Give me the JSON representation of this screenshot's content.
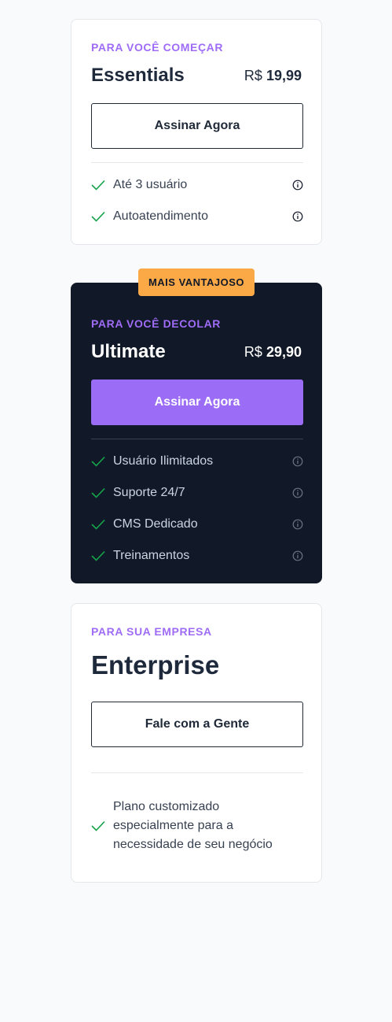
{
  "plans": [
    {
      "eyebrow": "PARA VOCÊ COMEÇAR",
      "name": "Essentials",
      "currency": "R$",
      "amount": "19,99",
      "cta": "Assinar Agora",
      "features": [
        "Até 3 usuário",
        "Autoatendimento"
      ]
    },
    {
      "badge": "MAIS VANTAJOSO",
      "eyebrow": "PARA VOCÊ DECOLAR",
      "name": "Ultimate",
      "currency": "R$",
      "amount": "29,90",
      "cta": "Assinar Agora",
      "features": [
        "Usuário Ilimitados",
        "Suporte 24/7",
        "CMS Dedicado",
        "Treinamentos"
      ]
    },
    {
      "eyebrow": "PARA SUA EMPRESA",
      "name": "Enterprise",
      "cta": "Fale com a Gente",
      "features": [
        "Plano customizado especialmente para a necessidade de seu negócio"
      ]
    }
  ],
  "icons": {
    "check": "check-icon",
    "info": "info-icon"
  },
  "colors": {
    "accent": "#9b6cf5",
    "badge": "#fba947",
    "dark_card": "#111827",
    "check": "#16a34a"
  }
}
